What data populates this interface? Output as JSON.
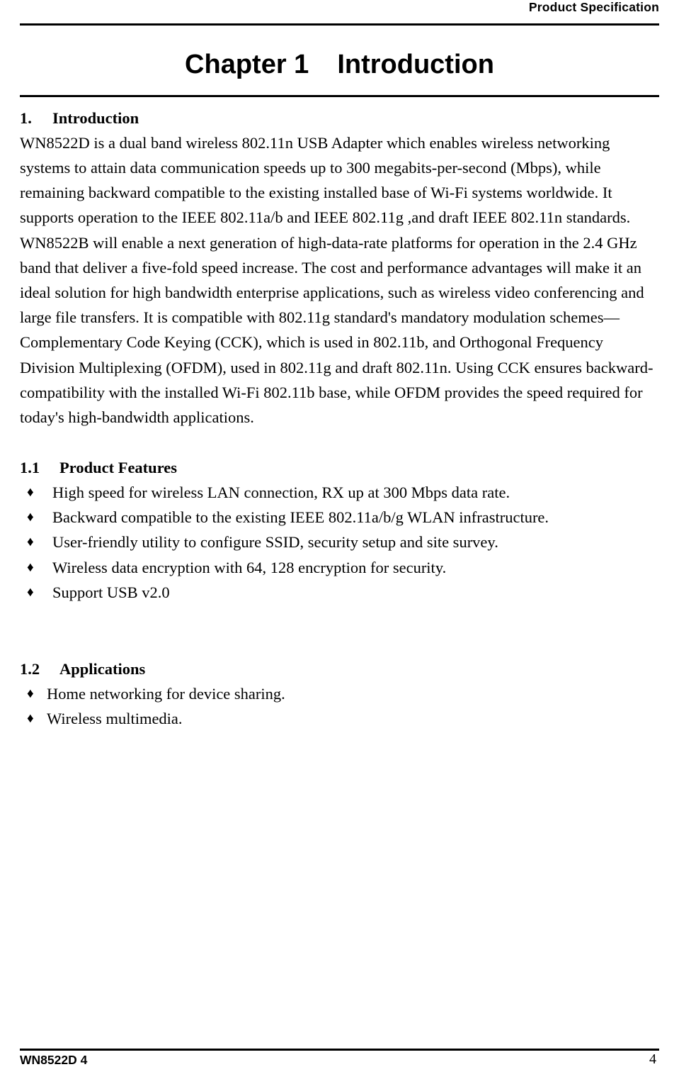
{
  "header": {
    "title": "Product Specification"
  },
  "chapter": {
    "label": "Chapter 1",
    "name": "Introduction"
  },
  "sections": {
    "intro": {
      "number": "1.",
      "title": "Introduction",
      "paragraph1": "WN8522D is a dual band wireless 802.11n USB Adapter which enables wireless networking systems to attain data communication speeds up to 300 megabits-per-second (Mbps), while remaining backward compatible to the existing installed base of Wi-Fi systems worldwide. It supports operation to the IEEE 802.11a/b and IEEE 802.11g ,and draft IEEE 802.11n standards.",
      "paragraph2": "WN8522B will enable a next generation of high-data-rate platforms for operation in the 2.4 GHz band that deliver a five-fold speed increase. The cost and performance advantages will make it an ideal solution for high bandwidth enterprise applications, such as wireless video conferencing and large file transfers. It is compatible with 802.11g standard's mandatory modulation schemes—Complementary Code Keying (CCK), which is used in 802.11b, and Orthogonal Frequency Division Multiplexing (OFDM), used in 802.11g and draft 802.11n. Using CCK ensures backward-compatibility with the installed Wi-Fi 802.11b base, while OFDM provides the speed required for today's high-bandwidth applications."
    },
    "features": {
      "number": "1.1",
      "title": "Product Features",
      "bullet_glyph": "♦",
      "items": [
        "High speed for wireless LAN connection, RX up at 300 Mbps data rate.",
        "Backward compatible to the existing IEEE 802.11a/b/g WLAN infrastructure.",
        "User-friendly utility to configure SSID, security setup and site survey.",
        "Wireless data encryption with 64, 128 encryption for security.",
        "Support USB v2.0"
      ]
    },
    "applications": {
      "number": "1.2",
      "title": "Applications",
      "bullet_glyph": "♦",
      "items": [
        "Home networking for device sharing.",
        "Wireless multimedia."
      ]
    }
  },
  "footer": {
    "left": "WN8522D 4",
    "page_number": "4"
  }
}
